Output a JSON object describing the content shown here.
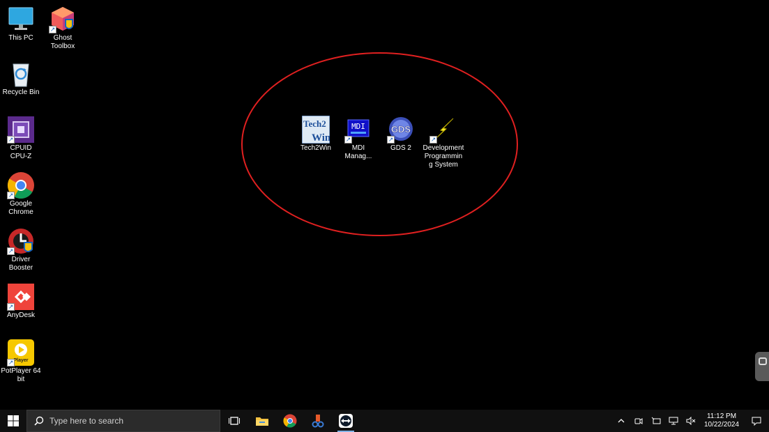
{
  "desktop": {
    "icons": [
      {
        "label": "This PC",
        "icon": "monitor-icon",
        "shortcut": false
      },
      {
        "label": "Ghost\nToolbox",
        "icon": "cube-shield-icon",
        "shortcut": true
      },
      {
        "label": "Recycle Bin",
        "icon": "recycle-bin-icon",
        "shortcut": false
      },
      {
        "label": "CPUID\nCPU-Z",
        "icon": "cpu-chip-icon",
        "shortcut": true
      },
      {
        "label": "Google\nChrome",
        "icon": "chrome-icon",
        "shortcut": true
      },
      {
        "label": "Driver\nBooster",
        "icon": "driver-booster-icon",
        "shortcut": true
      },
      {
        "label": "AnyDesk",
        "icon": "anydesk-icon",
        "shortcut": true
      },
      {
        "label": "PotPlayer 64\nbit",
        "icon": "potplayer-icon",
        "shortcut": true
      }
    ],
    "highlighted_icons": [
      {
        "label": "Tech2Win",
        "icon": "tech2win-icon",
        "logo_text_1": "Tech2",
        "logo_text_2": "Win",
        "shortcut": false
      },
      {
        "label": "MDI\nManag...",
        "icon": "mdi-icon",
        "logo_text": "MDI",
        "shortcut": true
      },
      {
        "label": "GDS 2",
        "icon": "gds-icon",
        "logo_text": "GDS",
        "shortcut": true
      },
      {
        "label": "Development\nProgrammin\ng System",
        "icon": "lightning-icon",
        "shortcut": true
      }
    ]
  },
  "taskbar": {
    "search_placeholder": "Type here to search",
    "apps": [
      "task-view-icon",
      "file-explorer-icon",
      "chrome-icon",
      "scissors-app-icon",
      "teamviewer-icon"
    ],
    "active_app": "teamviewer-icon",
    "clock": {
      "time": "11:12 PM",
      "date": "10/22/2024"
    }
  },
  "colors": {
    "highlight": "#e02020",
    "taskbar": "#101010",
    "desktop": "#000000"
  }
}
